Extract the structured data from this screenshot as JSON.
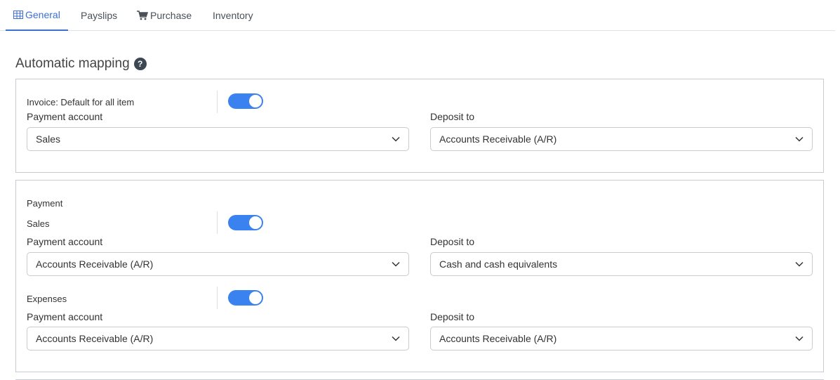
{
  "tabs": [
    {
      "label": "General",
      "icon": "table-icon",
      "active": true
    },
    {
      "label": "Payslips",
      "icon": null,
      "active": false
    },
    {
      "label": "Purchase",
      "icon": "cart-icon",
      "active": false
    },
    {
      "label": "Inventory",
      "icon": null,
      "active": false
    }
  ],
  "section": {
    "title": "Automatic mapping",
    "help_icon": "question-circle-icon",
    "help_glyph": "?"
  },
  "invoice": {
    "label": "Invoice: Default for all item",
    "toggle_on": true,
    "payment_account_label": "Payment account",
    "payment_account_value": "Sales",
    "deposit_to_label": "Deposit to",
    "deposit_to_value": "Accounts Receivable (A/R)"
  },
  "payment": {
    "heading": "Payment",
    "sales": {
      "label": "Sales",
      "toggle_on": true,
      "payment_account_label": "Payment account",
      "payment_account_value": "Accounts Receivable (A/R)",
      "deposit_to_label": "Deposit to",
      "deposit_to_value": "Cash and cash equivalents"
    },
    "expenses": {
      "label": "Expenses",
      "toggle_on": true,
      "payment_account_label": "Payment account",
      "payment_account_value": "Accounts Receivable (A/R)",
      "deposit_to_label": "Deposit to",
      "deposit_to_value": "Accounts Receivable (A/R)"
    }
  },
  "colors": {
    "accent": "#3b6fd4",
    "toggle_on": "#3a82f0"
  }
}
